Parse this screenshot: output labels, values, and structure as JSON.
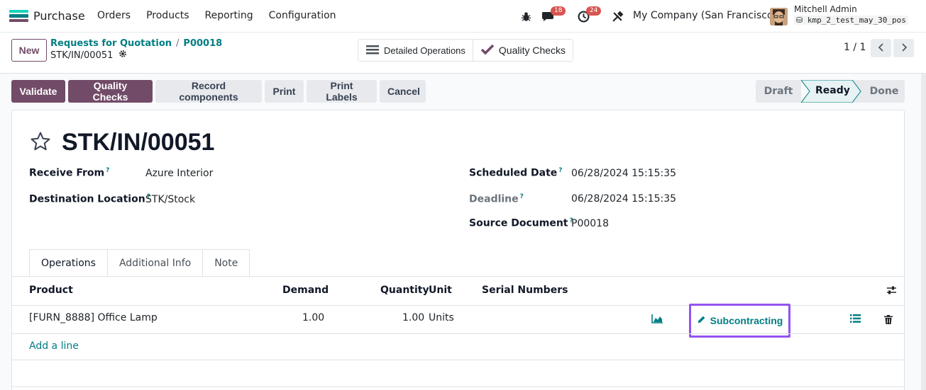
{
  "app": {
    "name": "Purchase",
    "icon_colors": [
      "#1ad3bb",
      "#017e84",
      "#714b67"
    ]
  },
  "menu": [
    "Orders",
    "Products",
    "Reporting",
    "Configuration"
  ],
  "systray": {
    "messages_count": "18",
    "activities_count": "24",
    "company": "My Company (San Francisco)",
    "user_name": "Mitchell Admin",
    "database": "kmp_2_test_may_30_pos"
  },
  "control_panel": {
    "new_label": "New",
    "breadcrumb": [
      "Requests for Quotation",
      "P00018"
    ],
    "record_name": "STK/IN/00051",
    "smart_buttons": [
      "Detailed Operations",
      "Quality Checks"
    ],
    "pager": "1 / 1"
  },
  "actions": {
    "validate": "Validate",
    "quality_checks": "Quality Checks",
    "record_components": "Record components",
    "print": "Print",
    "print_labels": "Print Labels",
    "cancel": "Cancel"
  },
  "status": {
    "stages": [
      "Draft",
      "Ready",
      "Done"
    ],
    "current": "Ready"
  },
  "form": {
    "title": "STK/IN/00051",
    "receive_from_label": "Receive From",
    "receive_from": "Azure Interior",
    "destination_label": "Destination Location",
    "destination": "STK/Stock",
    "scheduled_date_label": "Scheduled Date",
    "scheduled_date": "06/28/2024 15:15:35",
    "deadline_label": "Deadline",
    "deadline": "06/28/2024 15:15:35",
    "source_document_label": "Source Document",
    "source_document": "P00018",
    "help_mark": "?"
  },
  "tabs": [
    "Operations",
    "Additional Info",
    "Note"
  ],
  "table": {
    "headers": {
      "product": "Product",
      "demand": "Demand",
      "quantity": "Quantity",
      "unit": "Unit",
      "serial_numbers": "Serial Numbers"
    },
    "rows": [
      {
        "product": "[FURN_8888] Office Lamp",
        "demand": "1.00",
        "quantity": "1.00",
        "unit": "Units",
        "action": "Subcontracting"
      }
    ],
    "add_line": "Add a line"
  },
  "colors": {
    "primary": "#714b67",
    "link": "#017e84",
    "highlight": "#9353f0",
    "badge": "#d9534f"
  }
}
